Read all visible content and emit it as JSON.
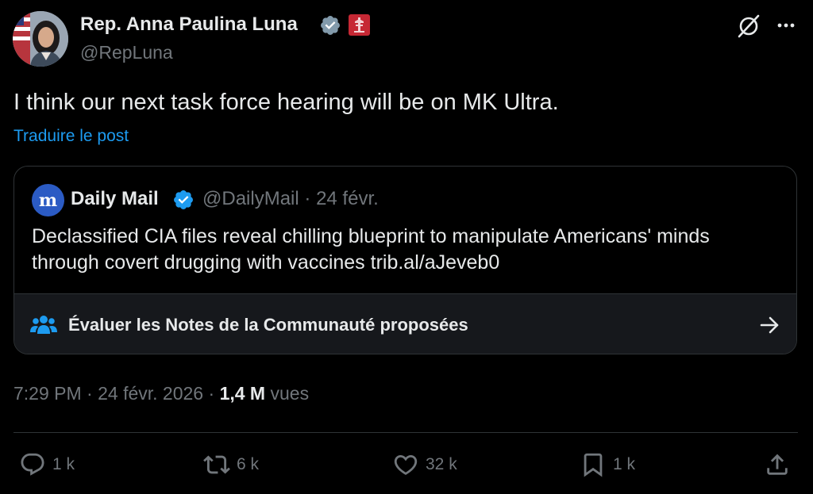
{
  "author": {
    "name": "Rep. Anna Paulina Luna",
    "handle": "@RepLuna",
    "verified_color": "#829aab",
    "affiliation_color": "#c62834"
  },
  "post": {
    "text": "I think our next task force hearing will be on MK Ultra.",
    "translate_label": "Traduire le post"
  },
  "quote": {
    "avatar_letter": "m",
    "name": "Daily Mail",
    "handle": "@DailyMail",
    "separator": "·",
    "date": "24 févr.",
    "text_line1": "Declassified CIA files reveal chilling blueprint to manipulate Americans' minds",
    "text_line2": "through covert drugging with vaccines trib.al/aJeveb0",
    "verified_color": "#1d9bf0"
  },
  "community_notes": {
    "label": "Évaluer les Notes de la Communauté proposées"
  },
  "meta": {
    "time": "7:29 PM",
    "sep1": " · ",
    "date": "24 févr. 2026",
    "sep2": " · ",
    "views_count": "1,4 M",
    "views_label": " vues"
  },
  "actions": {
    "replies": "1 k",
    "reposts": "6 k",
    "likes": "32 k",
    "bookmarks": "1 k"
  },
  "colors": {
    "background": "#000000",
    "text": "#e7e9ea",
    "secondary": "#71767b",
    "accent": "#1d9bf0",
    "border": "#2f3336"
  },
  "icons": [
    "grok-icon",
    "more-icon",
    "verified-icon",
    "affiliation-badge-icon",
    "community-icon",
    "arrow-right-icon",
    "reply-icon",
    "retweet-icon",
    "like-icon",
    "bookmark-icon",
    "share-icon"
  ]
}
